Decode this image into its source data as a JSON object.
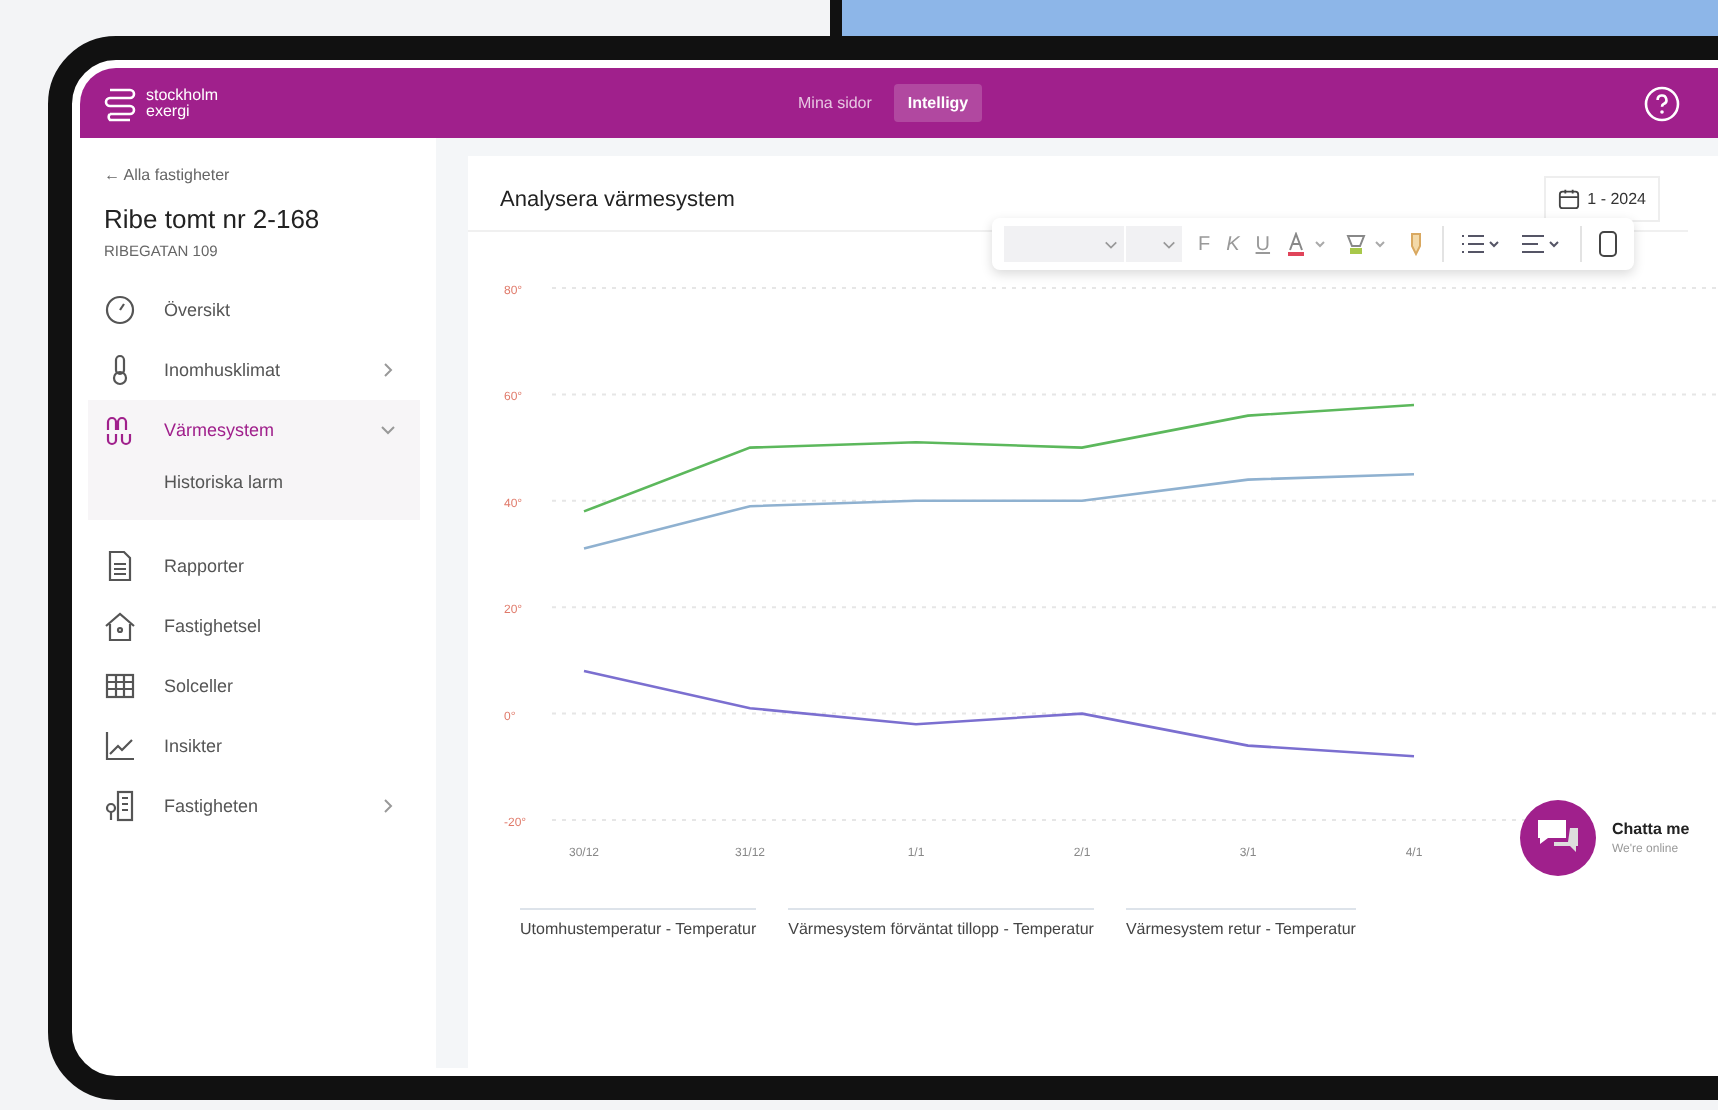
{
  "header": {
    "logo": [
      "stockholm",
      "exergi"
    ],
    "tabs": [
      {
        "label": "Mina sidor",
        "selected": false
      },
      {
        "label": "Intelligy",
        "selected": true
      }
    ]
  },
  "sidebar": {
    "back": "← Alla fastigheter",
    "property_name": "Ribe tomt nr 2-168",
    "address": "RIBEGATAN 109",
    "items": [
      {
        "label": "Översikt",
        "kind": "link",
        "selected": false
      },
      {
        "label": "Inomhusklimat",
        "kind": "group",
        "selected": false,
        "expanded": false
      },
      {
        "label": "Värmesystem",
        "kind": "group",
        "selected": true,
        "expanded": true,
        "children": [
          {
            "label": "Historiska larm"
          }
        ]
      },
      {
        "label": "Rapporter",
        "kind": "link",
        "selected": false
      },
      {
        "label": "Fastighetsel",
        "kind": "link",
        "selected": false
      },
      {
        "label": "Solceller",
        "kind": "link",
        "selected": false
      },
      {
        "label": "Insikter",
        "kind": "link",
        "selected": false
      },
      {
        "label": "Fastigheten",
        "kind": "group",
        "selected": false,
        "expanded": false
      }
    ]
  },
  "card": {
    "title": "Analysera värmesystem",
    "date_button": "1 - 2024",
    "toolbar": {
      "letters": [
        "F",
        "K",
        "U"
      ]
    },
    "chart_data": {
      "type": "line",
      "grid": true,
      "categories": [
        "30/12",
        "31/12",
        "1/1",
        "2/1",
        "3/1",
        "4/1"
      ],
      "yticks": [
        {
          "value": 80,
          "label": "80°"
        },
        {
          "value": 60,
          "label": "60°"
        },
        {
          "value": 40,
          "label": "40°"
        },
        {
          "value": 20,
          "label": "20°"
        },
        {
          "value": 0,
          "label": "0°"
        },
        {
          "value": -20,
          "label": "-20°"
        }
      ],
      "ylim": [
        -20,
        80
      ],
      "series": [
        {
          "name": "Utomhustemperatur - Temperatur",
          "color": "#7b6fd0",
          "values": [
            8,
            1,
            -2,
            0,
            -6,
            -8
          ]
        },
        {
          "name": "Värmesystem förväntat tillopp - Temperatur",
          "color": "#5cb85c",
          "values": [
            38,
            50,
            51,
            50,
            56,
            58
          ]
        },
        {
          "name": "Värmesystem retur - Temperatur",
          "color": "#8fb1d0",
          "values": [
            31,
            39,
            40,
            40,
            44,
            45
          ]
        }
      ]
    }
  },
  "chat": {
    "title": "Chatta me",
    "status": "We're online"
  }
}
